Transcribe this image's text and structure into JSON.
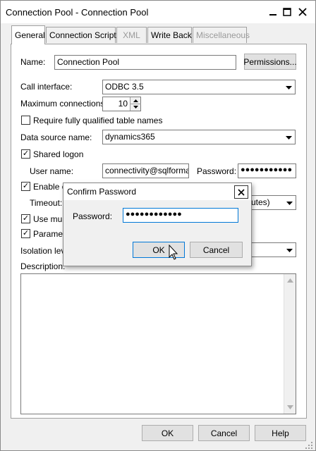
{
  "window": {
    "title": "Connection Pool - Connection Pool"
  },
  "tabs": [
    {
      "label": "General",
      "active": true,
      "enabled": true
    },
    {
      "label": "Connection Scripts",
      "active": false,
      "enabled": true
    },
    {
      "label": "XML",
      "active": false,
      "enabled": false
    },
    {
      "label": "Write Back",
      "active": false,
      "enabled": true
    },
    {
      "label": "Miscellaneous",
      "active": false,
      "enabled": false
    }
  ],
  "general": {
    "name_label": "Name:",
    "name_value": "Connection Pool",
    "permissions_label": "Permissions...",
    "call_interface_label": "Call interface:",
    "call_interface_value": "ODBC 3.5",
    "max_connections_label": "Maximum connections:",
    "max_connections_value": "10",
    "require_qualified_label": "Require fully qualified table names",
    "require_qualified_checked": false,
    "data_source_label": "Data source name:",
    "data_source_value": "dynamics365",
    "shared_logon_label": "Shared logon",
    "shared_logon_checked": true,
    "user_name_label": "User name:",
    "user_name_value": "connectivity@sqlformatc",
    "password_label": "Password:",
    "password_value": "●●●●●●●●●●●",
    "enable_label": "Enable c",
    "enable_checked": true,
    "timeout_label": "Timeout:",
    "timeout_unit_fragment": "utes)",
    "use_multi_label": "Use multi",
    "use_multi_checked": true,
    "parameter_label": "Paramete",
    "parameter_checked": true,
    "isolation_label": "Isolation leve",
    "description_label": "Description:"
  },
  "footer": {
    "ok_label": "OK",
    "cancel_label": "Cancel",
    "help_label": "Help"
  },
  "confirm_dialog": {
    "title": "Confirm Password",
    "password_label": "Password:",
    "password_value": "●●●●●●●●●●●●",
    "ok_label": "OK",
    "cancel_label": "Cancel"
  },
  "icons": {
    "minimize": "minimize-icon",
    "maximize": "maximize-icon",
    "close": "close-icon",
    "dropdown": "chevron-down-icon",
    "cursor": "mouse-pointer-icon"
  },
  "colors": {
    "focus_border": "#0078d7",
    "panel_bg": "#ffffff",
    "window_bg": "#f0f0f0"
  }
}
